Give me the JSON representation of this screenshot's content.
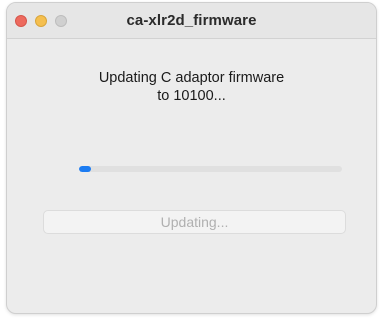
{
  "window": {
    "title": "ca-xlr2d_firmware"
  },
  "traffic_lights": {
    "close_color": "#ed6a5e",
    "minimize_color": "#f5bf4f",
    "zoom_color": "#d0d0d0"
  },
  "dialog": {
    "message_line1": "Updating C adaptor firmware",
    "message_line2": "to 10100...",
    "progress_fraction": 0.04,
    "button_label": "Updating...",
    "button_enabled": false
  },
  "colors": {
    "accent": "#1c7cf2"
  }
}
